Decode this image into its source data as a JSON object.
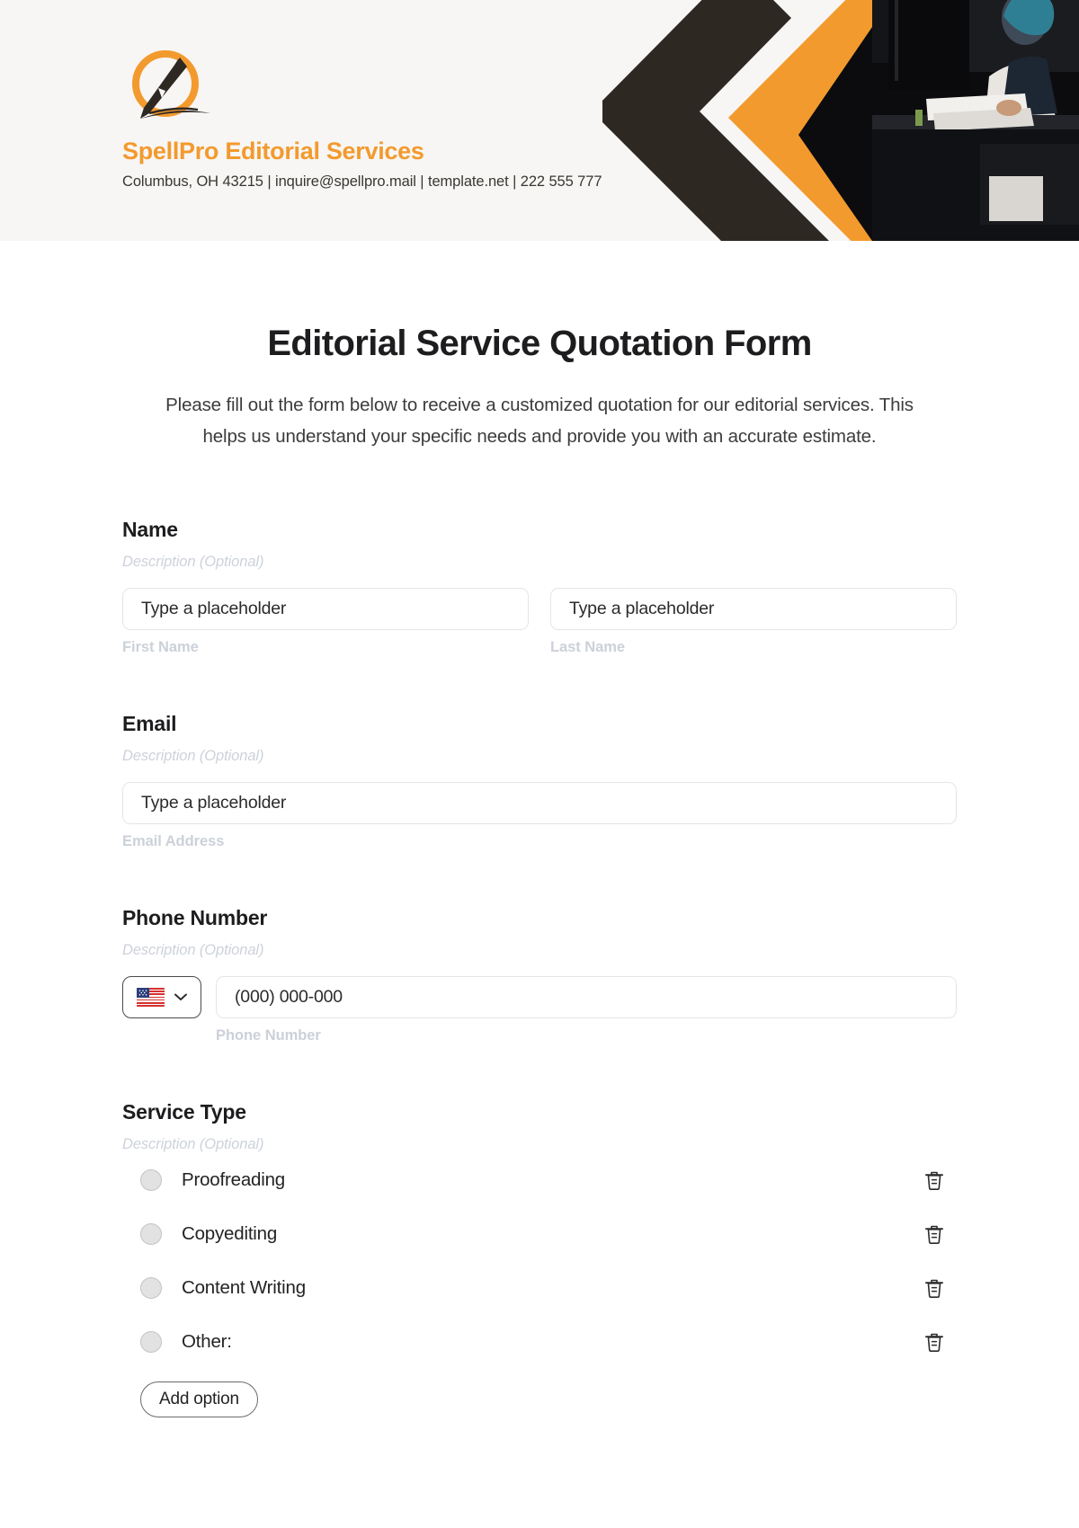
{
  "header": {
    "logo_icon": "fountain-pen-nib-in-circle-logo",
    "brand_name": "SpellPro Editorial Services",
    "contact_line": "Columbus, OH 43215 | inquire@spellpro.mail | template.net | 222 555 777",
    "background_color": "#f7f6f4",
    "accent_color": "#f39a2e",
    "dark_color": "#2e2823",
    "chevron_icons": [
      "chevron-left-dark",
      "chevron-left-orange"
    ],
    "photo_alt": "person working at a desk"
  },
  "form": {
    "title": "Editorial Service Quotation Form",
    "subtitle": "Please fill out the form below to receive a customized quotation for our editorial services. This helps us understand your specific needs and provide you with an accurate estimate.",
    "fields": [
      {
        "label": "Name",
        "description": "Description (Optional)",
        "inputs": [
          {
            "placeholder": "Type a placeholder",
            "value": "",
            "sublabel": "First Name"
          },
          {
            "placeholder": "Type a placeholder",
            "value": "",
            "sublabel": "Last Name"
          }
        ]
      },
      {
        "label": "Email",
        "description": "Description (Optional)",
        "inputs": [
          {
            "placeholder": "Type a placeholder",
            "value": "",
            "sublabel": "Email Address"
          }
        ]
      },
      {
        "label": "Phone Number",
        "description": "Description (Optional)",
        "country_code_flag": "us-flag",
        "country_chevron": "chevron-down-icon",
        "inputs": [
          {
            "placeholder": "(000) 000-000",
            "value": "",
            "sublabel": "Phone Number"
          }
        ]
      },
      {
        "label": "Service Type",
        "description": "Description (Optional)",
        "options": [
          {
            "label": "Proofreading",
            "selected": false,
            "delete_icon": "trash-icon"
          },
          {
            "label": "Copyediting",
            "selected": false,
            "delete_icon": "trash-icon"
          },
          {
            "label": "Content Writing",
            "selected": false,
            "delete_icon": "trash-icon"
          },
          {
            "label": "Other:",
            "selected": false,
            "delete_icon": "trash-icon"
          }
        ],
        "add_option_label": "Add option"
      }
    ]
  }
}
